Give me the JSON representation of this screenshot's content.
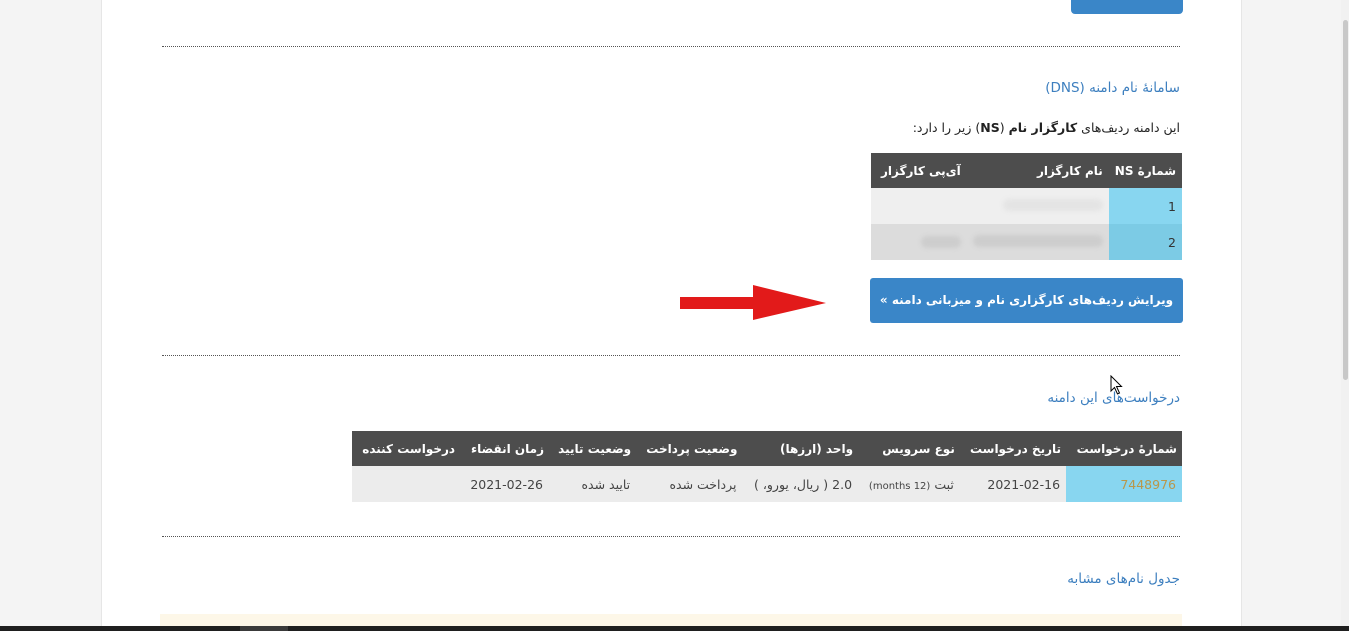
{
  "dns_section": {
    "title": "سامانهٔ نام دامنه (DNS)",
    "intro_before": "این دامنه ردیف‌های ",
    "intro_bold_1": "کارگزار نام",
    "intro_middle": " (",
    "intro_bold_2": "NS",
    "intro_after": ") زیر را دارد:",
    "table": {
      "headers": [
        "شمارهٔ NS",
        "نام کارگزار",
        "آی‌پی کارگزار"
      ],
      "rows": [
        {
          "number": "1",
          "server_name": "",
          "server_ip": ""
        },
        {
          "number": "2",
          "server_name": "",
          "server_ip": ""
        }
      ]
    },
    "edit_button_label": "ویرایش ردیف‌های کارگزاری نام و میزبانی دامنه »"
  },
  "requests_section": {
    "title": "درخواست‌های این دامنه",
    "table": {
      "headers": [
        "شمارهٔ درخواست",
        "تاریخ درخواست",
        "نوع سرویس",
        "واحد (ارزها)",
        "وضعیت پرداخت",
        "وضعیت تایید",
        "زمان انقضاء",
        "درخواست کننده"
      ],
      "rows": [
        {
          "request_id": "7448976",
          "request_date": "2021-02-16",
          "service_type": "ثبت",
          "service_period": "(12 months)",
          "unit": "2.0 ( ریال، یورو، )",
          "payment_status": "پرداخت شده",
          "approval_status": "تایید شده",
          "expiry": "2021-02-26",
          "requester": ""
        }
      ]
    }
  },
  "similar_section": {
    "title": "جدول نام‌های مشابه"
  },
  "colors": {
    "accent": "#3a86c8",
    "link": "#3d7fbf",
    "header_bg": "#4d4d4d",
    "highlight_cell": "#88d6f0",
    "annotation_arrow": "#e21a1a"
  }
}
